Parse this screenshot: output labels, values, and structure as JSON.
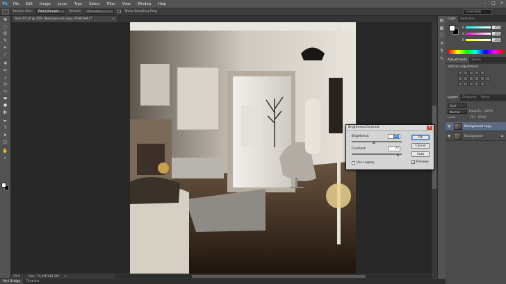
{
  "app": {
    "logo": "Ps"
  },
  "menu": [
    "File",
    "Edit",
    "Image",
    "Layer",
    "Type",
    "Select",
    "Filter",
    "View",
    "Window",
    "Help"
  ],
  "window_controls": [
    "–",
    "□",
    "×"
  ],
  "options": {
    "sample_size_label": "Sample Size:",
    "sample_size_value": "Point Sample",
    "sample_label": "Sample:",
    "sample_value": "All Layers",
    "show_ring_label": "Show Sampling Ring",
    "workspace": "Essentials"
  },
  "document": {
    "tab": "Rum 05.tif @ 25% (Background copy, RGB/16#) *",
    "close": "×"
  },
  "status": {
    "zoom": "25%",
    "docsize": "Doc: 74,4M/148,9M",
    "arrow": "▸"
  },
  "bottom_tabs": [
    "Mini Bridge",
    "Timeline"
  ],
  "panels": {
    "color_tabs": [
      "Color",
      "Swatches"
    ],
    "color_rows": [
      {
        "label": "R",
        "value": "255"
      },
      {
        "label": "G",
        "value": "255"
      },
      {
        "label": "B",
        "value": "255"
      }
    ],
    "adj_tabs": [
      "Adjustments",
      "Styles"
    ],
    "adj_title": "Add an adjustment",
    "layer_tabs": [
      "Layers",
      "Channels",
      "Paths"
    ],
    "kind_label": "Kind",
    "blend_mode": "Normal",
    "opacity_label": "Opacity:",
    "opacity_value": "100%",
    "lock_label": "Lock:",
    "fill_label": "Fill:",
    "fill_value": "100%",
    "layers": [
      {
        "name": "Background copy",
        "selected": true
      },
      {
        "name": "Background",
        "selected": false
      }
    ]
  },
  "dialog": {
    "title": "Brightness/Contrast",
    "close": "×",
    "brightness_label": "Brightness:",
    "brightness_value": "35",
    "contrast_label": "Contrast:",
    "contrast_value": "77",
    "brightness_fraction": 0.43,
    "contrast_fraction": 0.91,
    "ok": "OK",
    "cancel": "Cancel",
    "auto": "Auto",
    "use_legacy": "Use Legacy",
    "preview": "Preview",
    "preview_checked": true,
    "legacy_checked": false
  },
  "colors": {
    "menubar": "#535353",
    "panel": "#4b4b4b",
    "selection": "#5b6a82",
    "dialog_bg": "#d4d4d4"
  }
}
